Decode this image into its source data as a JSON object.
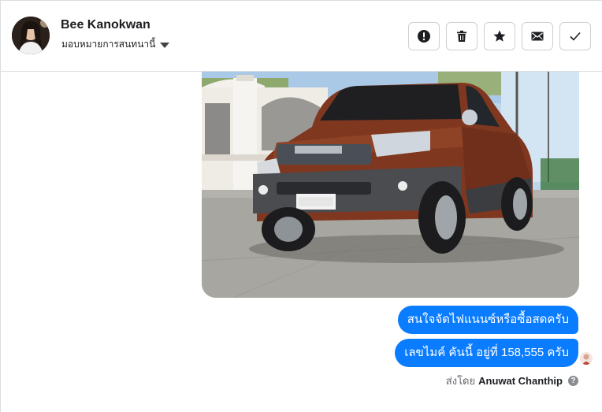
{
  "contact": {
    "name": "Bee Kanokwan",
    "assign_label": "มอบหมายการสนทนานี้"
  },
  "toolbar": {
    "buttons": [
      {
        "name": "report-button",
        "icon": "exclamation-icon"
      },
      {
        "name": "delete-button",
        "icon": "trash-icon"
      },
      {
        "name": "star-button",
        "icon": "star-icon"
      },
      {
        "name": "mark-unread-button",
        "icon": "envelope-icon"
      },
      {
        "name": "done-button",
        "icon": "check-icon"
      }
    ]
  },
  "messages": [
    {
      "text": "สนใจจัดไฟแนนซ์หรือซื้อสดครับ"
    },
    {
      "text": "เลขไมค์ คันนี้ อยู่ที่ 158,555 ครับ"
    }
  ],
  "sent_by": {
    "prefix": "ส่งโดย",
    "agent": "Anuwat Chanthip",
    "help_glyph": "?"
  },
  "colors": {
    "bubble": "#0a7cff",
    "car_body": "#8a3d23",
    "border": "#dadde1"
  }
}
